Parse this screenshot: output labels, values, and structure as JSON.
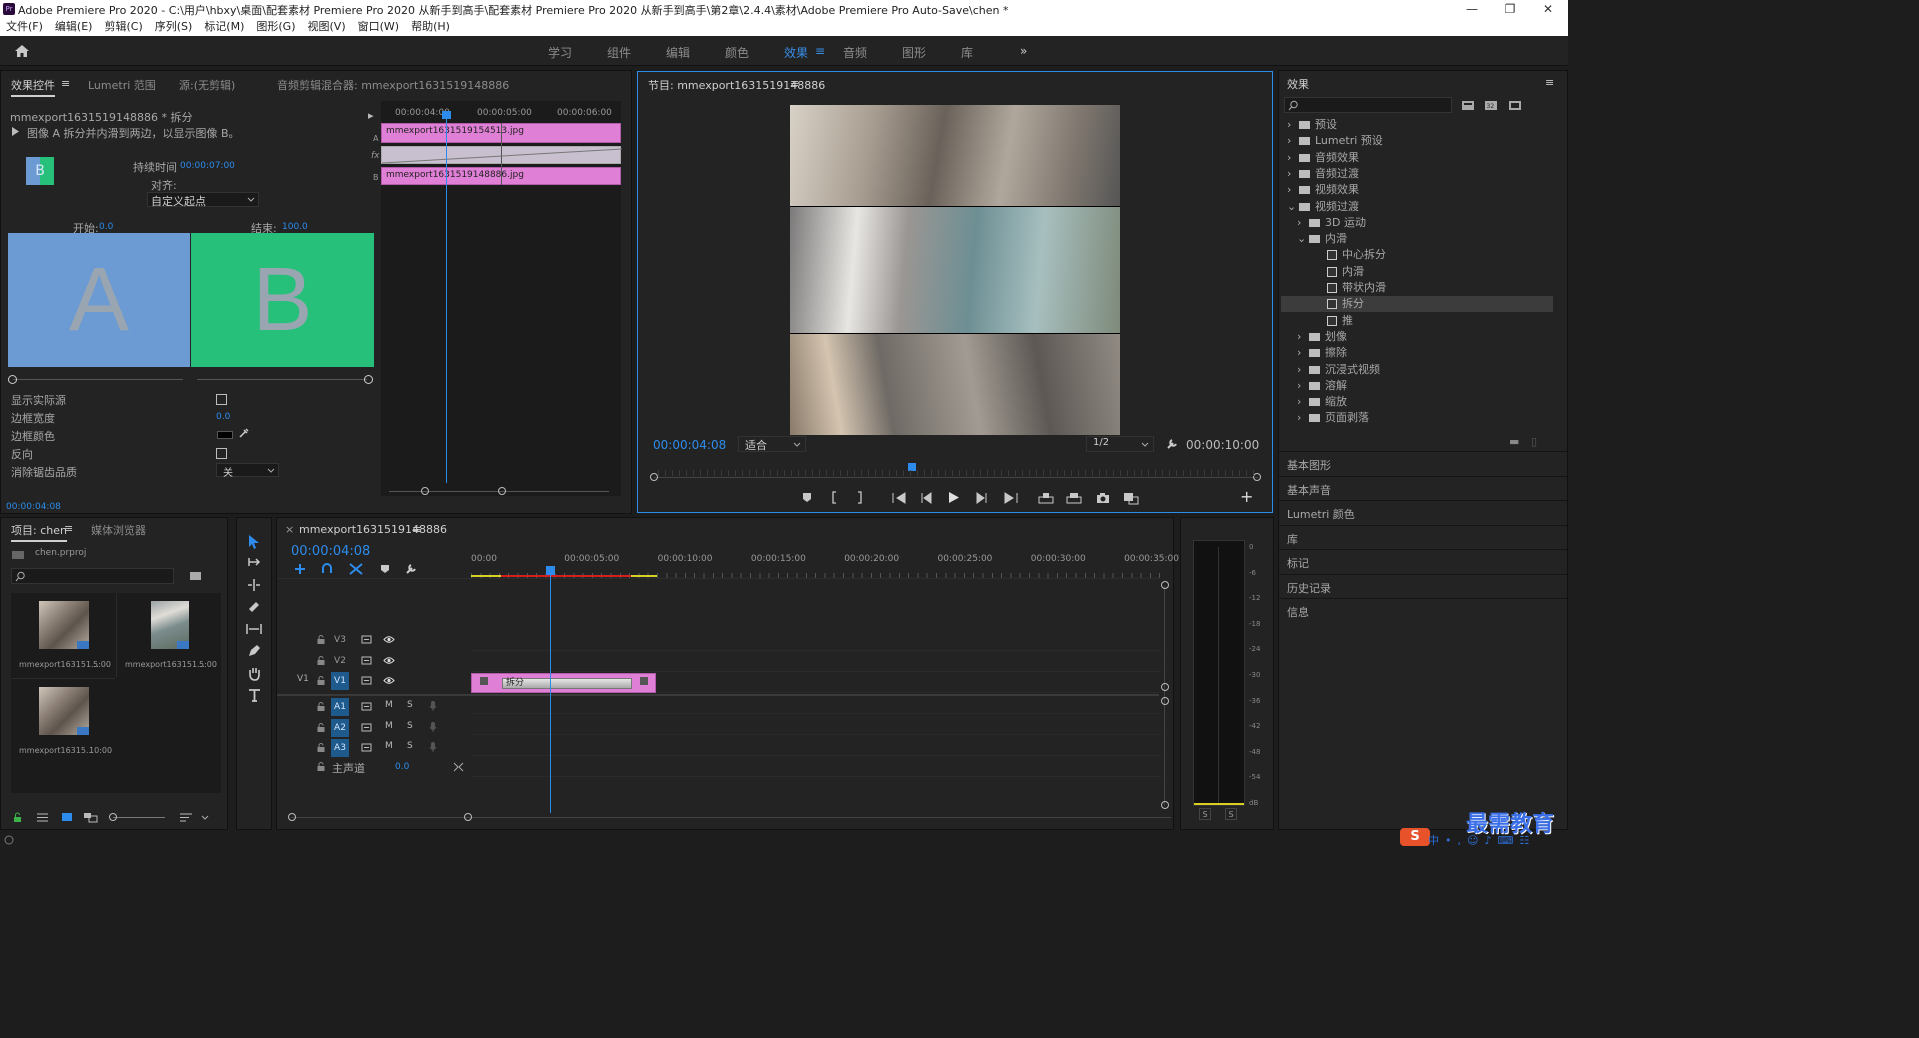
{
  "title": "Adobe Premiere Pro 2020 - C:\\用户\\hbxy\\桌面\\配套素材 Premiere Pro 2020 从新手到高手\\配套素材 Premiere Pro 2020 从新手到高手\\第2章\\2.4.4\\素材\\Adobe Premiere Pro Auto-Save\\chen *",
  "app_badge": "Pr",
  "window_controls": [
    "—",
    "❐",
    "✕"
  ],
  "menu": [
    "文件(F)",
    "编辑(E)",
    "剪辑(C)",
    "序列(S)",
    "标记(M)",
    "图形(G)",
    "视图(V)",
    "窗口(W)",
    "帮助(H)"
  ],
  "workspaces": [
    "学习",
    "组件",
    "编辑",
    "颜色",
    "效果",
    "音频",
    "图形",
    "库"
  ],
  "workspace_menu_glyph": "≡",
  "workspace_more": "»",
  "effect_controls": {
    "tabs": [
      "效果控件",
      "Lumetri 范围",
      "源:(无剪辑)",
      "音频剪辑混合器: mmexport1631519148886"
    ],
    "tab_menu_glyph": "≡",
    "clip": "mmexport1631519148886 * 拆分",
    "clip_arrow": "▸",
    "description": "图像 A 拆分并内滑到两边，以显示图像 B。",
    "duration_label": "持续时间",
    "duration": "00:00:07:00",
    "align_label": "对齐:",
    "align_value": "自定义起点",
    "start_label": "开始:",
    "start": "0.0",
    "end_label": "结束:",
    "end": "100.0",
    "preview_a": "A",
    "preview_b": "B",
    "thumb_b": "B",
    "props": [
      {
        "label": "显示实际源",
        "value": ""
      },
      {
        "label": "边框宽度",
        "value": "0.0"
      },
      {
        "label": "边框颜色",
        "value": ""
      },
      {
        "label": "反向",
        "value": ""
      },
      {
        "label": "消除锯齿品质",
        "value": "关"
      }
    ],
    "mini_times": [
      "00:00:04:00",
      "00:00:05:00",
      "00:00:06:00"
    ],
    "clip_a": "mmexport1631519154513.jpg",
    "clip_b": "mmexport1631519148886.jpg",
    "track_letters": [
      "A",
      "fx",
      "B"
    ],
    "timecode": "00:00:04:08"
  },
  "program": {
    "title": "节目: mmexport1631519148886",
    "menu_glyph": "≡",
    "timecode": "00:00:04:08",
    "fit": "适合",
    "quality": "1/2",
    "duration": "00:00:10:00",
    "add_glyph": "+"
  },
  "effects": {
    "title": "效果",
    "menu_glyph": "≡",
    "tree": [
      {
        "label": "预设",
        "level": 0,
        "type": "folder",
        "arrow": "›"
      },
      {
        "label": "Lumetri 预设",
        "level": 0,
        "type": "folder",
        "arrow": "›"
      },
      {
        "label": "音频效果",
        "level": 0,
        "type": "folder",
        "arrow": "›"
      },
      {
        "label": "音频过渡",
        "level": 0,
        "type": "folder",
        "arrow": "›"
      },
      {
        "label": "视频效果",
        "level": 0,
        "type": "folder",
        "arrow": "›"
      },
      {
        "label": "视频过渡",
        "level": 0,
        "type": "folder",
        "arrow": "⌄"
      },
      {
        "label": "3D 运动",
        "level": 1,
        "type": "folder",
        "arrow": "›"
      },
      {
        "label": "内滑",
        "level": 1,
        "type": "folder",
        "arrow": "⌄"
      },
      {
        "label": "中心拆分",
        "level": 2,
        "type": "fx"
      },
      {
        "label": "内滑",
        "level": 2,
        "type": "fx"
      },
      {
        "label": "带状内滑",
        "level": 2,
        "type": "fx"
      },
      {
        "label": "拆分",
        "level": 2,
        "type": "fx",
        "selected": true
      },
      {
        "label": "推",
        "level": 2,
        "type": "fx"
      },
      {
        "label": "划像",
        "level": 1,
        "type": "folder",
        "arrow": "›"
      },
      {
        "label": "擦除",
        "level": 1,
        "type": "folder",
        "arrow": "›"
      },
      {
        "label": "沉浸式视频",
        "level": 1,
        "type": "folder",
        "arrow": "›"
      },
      {
        "label": "溶解",
        "level": 1,
        "type": "folder",
        "arrow": "›"
      },
      {
        "label": "缩放",
        "level": 1,
        "type": "folder",
        "arrow": "›"
      },
      {
        "label": "页面剥落",
        "level": 1,
        "type": "folder",
        "arrow": "›"
      }
    ],
    "sections": [
      "基本图形",
      "基本声音",
      "Lumetri 颜色",
      "库",
      "标记",
      "历史记录",
      "信息"
    ]
  },
  "project": {
    "tabs": [
      "项目: chen",
      "媒体浏览器"
    ],
    "tab_menu_glyph": "≡",
    "file": "chen.prproj",
    "items": [
      {
        "name": "mmexport163151...",
        "dur": "5:00"
      },
      {
        "name": "mmexport163151...",
        "dur": "5:00"
      },
      {
        "name": "mmexport16315...",
        "dur": "10:00"
      }
    ]
  },
  "timeline": {
    "close_glyph": "×",
    "tab": "mmexport1631519148886",
    "tab_menu_glyph": "≡",
    "timecode": "00:00:04:08",
    "ruler": [
      "00:00",
      "00:00:05:00",
      "00:00:10:00",
      "00:00:15:00",
      "00:00:20:00",
      "00:00:25:00",
      "00:00:30:00",
      "00:00:35:00"
    ],
    "video_tracks": [
      "V3",
      "V2",
      "V1"
    ],
    "src_patch": "V1",
    "audio_tracks": [
      "A1",
      "A2",
      "A3"
    ],
    "mute": "M",
    "solo": "S",
    "master": "主声道",
    "master_val": "0.0",
    "transition": "拆分"
  },
  "meter": {
    "scale": [
      "0",
      "-6",
      "-12",
      "-18",
      "-24",
      "-30",
      "-36",
      "-42",
      "-48",
      "-54",
      "dB"
    ],
    "solo": [
      "S",
      "S"
    ]
  },
  "watermark": "最需教育"
}
